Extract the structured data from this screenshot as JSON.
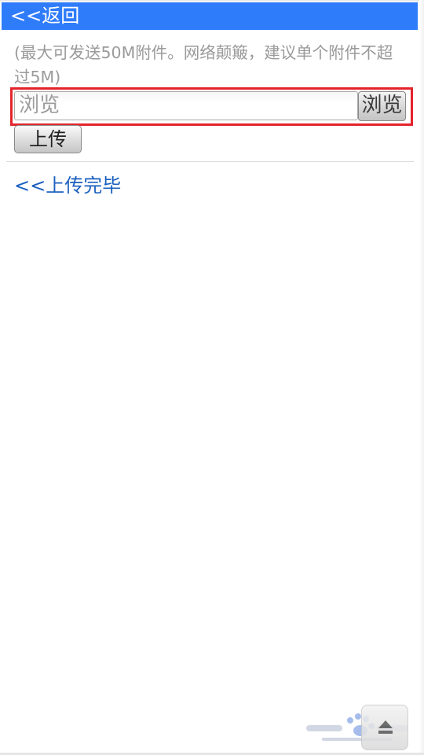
{
  "nav": {
    "back_label": "<<返回"
  },
  "upload": {
    "hint": "(最大可发送50M附件。网络颠簸，建议单个附件不超过5M)",
    "file_placeholder": "浏览",
    "browse_label": "浏览",
    "upload_label": "上传",
    "done_label": "<<上传完毕"
  },
  "colors": {
    "header_blue": "#2f7cfb",
    "link_blue": "#1a5fbf",
    "highlight_red": "#e3242b",
    "hint_gray": "#9a9a9a"
  },
  "icons": {
    "float_button": "eject-icon",
    "watermark": "baidu-paw-logo"
  }
}
